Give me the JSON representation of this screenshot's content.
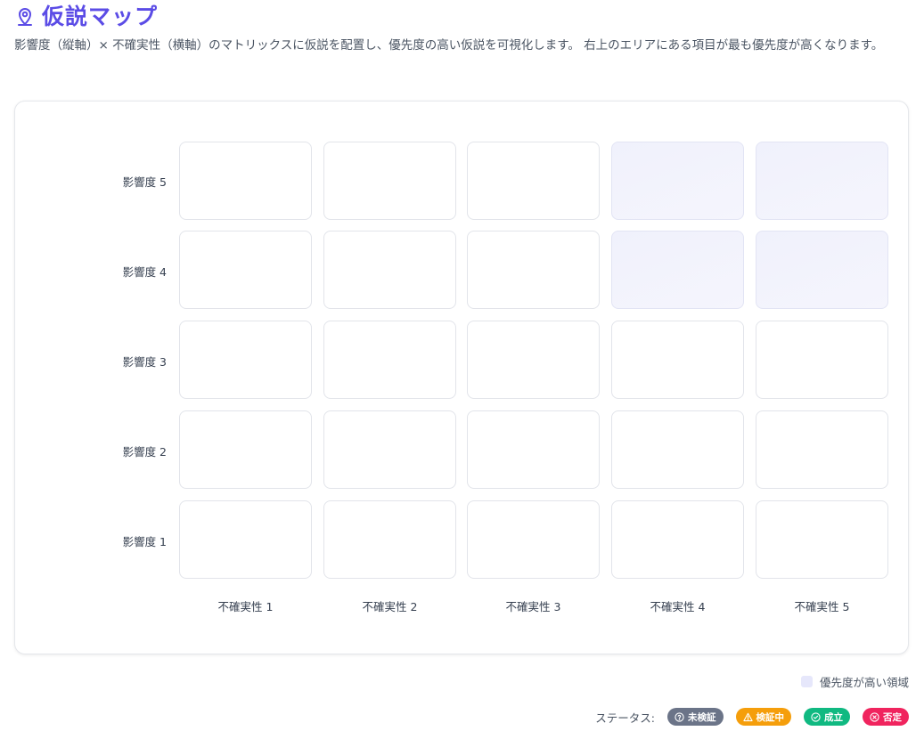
{
  "page": {
    "title": "仮説マップ",
    "description": "影響度（縦軸）× 不確実性（横軸）のマトリックスに仮説を配置し、優先度の高い仮説を可視化します。 右上のエリアにある項目が最も優先度が高くなります。",
    "title_color": "#5b4ce6"
  },
  "matrix": {
    "y_labels": [
      "影響度 5",
      "影響度 4",
      "影響度 3",
      "影響度 2",
      "影響度 1"
    ],
    "x_labels": [
      "不確実性 1",
      "不確実性 2",
      "不確実性 3",
      "不確実性 4",
      "不確実性 5"
    ],
    "high_priority_cells": [
      [
        0,
        3
      ],
      [
        0,
        4
      ],
      [
        1,
        3
      ],
      [
        1,
        4
      ]
    ]
  },
  "legend": {
    "high_priority_label": "優先度が高い領域",
    "swatch_color": "#e6e7fb"
  },
  "status": {
    "label": "ステータス:",
    "badges": [
      {
        "label": "未検証",
        "icon": "question-circle-icon",
        "color": "#6b7488"
      },
      {
        "label": "検証中",
        "icon": "warning-triangle-icon",
        "color": "#f59e0b"
      },
      {
        "label": "成立",
        "icon": "check-circle-icon",
        "color": "#10b981"
      },
      {
        "label": "否定",
        "icon": "x-circle-icon",
        "color": "#f0245e"
      }
    ]
  }
}
